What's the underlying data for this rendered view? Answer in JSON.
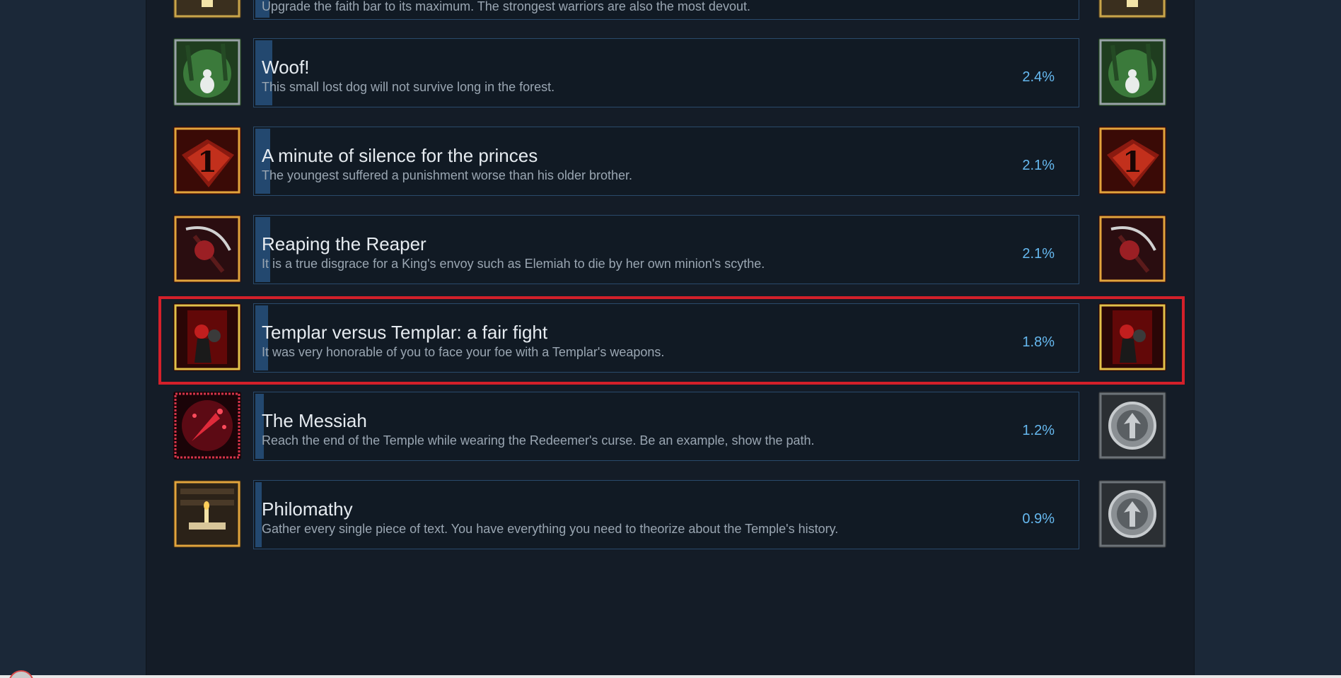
{
  "achievements": [
    {
      "title": "",
      "description": "Upgrade the faith bar to its maximum. The strongest warriors are also the most devout.",
      "percent": "",
      "icon_left": "candle-icon",
      "icon_right": "candle-icon",
      "progress": 0.02
    },
    {
      "title": "Woof!",
      "description": "This small lost dog will not survive long in the forest.",
      "percent": "2.4%",
      "icon_left": "lost-dog-forest-icon",
      "icon_right": "lost-dog-forest-icon",
      "progress": 0.024
    },
    {
      "title": "A minute of silence for the princes",
      "description": "The youngest suffered a punishment worse than his older brother.",
      "percent": "2.1%",
      "icon_left": "number-one-book-icon",
      "icon_right": "number-one-book-icon",
      "progress": 0.021
    },
    {
      "title": "Reaping the Reaper",
      "description": "It is a true disgrace for a King's envoy such as Elemiah to die by her own minion's scythe.",
      "percent": "2.1%",
      "icon_left": "reaper-scythe-icon",
      "icon_right": "reaper-scythe-icon",
      "progress": 0.021
    },
    {
      "title": "Templar versus Templar: a fair fight",
      "description": "It was very honorable of you to face your foe with a Templar's weapons.",
      "percent": "1.8%",
      "icon_left": "templar-duel-icon",
      "icon_right": "templar-duel-icon",
      "progress": 0.018
    },
    {
      "title": "The Messiah",
      "description": "Reach the end of the Temple while wearing the Redeemer's curse. Be an example, show the path.",
      "percent": "1.2%",
      "icon_left": "blood-curse-icon",
      "icon_right": "locked-emblem-icon",
      "progress": 0.012
    },
    {
      "title": "Philomathy",
      "description": "Gather every single piece of text. You have everything you need to theorize about the Temple's history.",
      "percent": "0.9%",
      "icon_left": "library-candle-icon",
      "icon_right": "locked-emblem-icon",
      "progress": 0.009
    }
  ],
  "highlighted_index": 4,
  "colors": {
    "background": "#1b2838",
    "panel": "#141c27",
    "card_border": "#2a4a6b",
    "progress_bar": "#23486f",
    "percent_text": "#66b9f0",
    "highlight": "#d4202a"
  }
}
